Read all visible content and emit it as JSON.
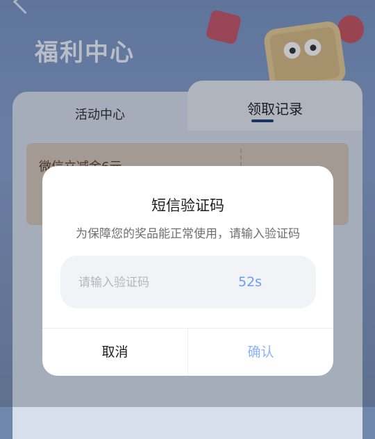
{
  "page": {
    "title": "福利中心",
    "tabs": [
      {
        "label": "活动中心",
        "active": false
      },
      {
        "label": "领取记录",
        "active": true
      }
    ],
    "card": {
      "text_partial": "微信立减金6元"
    }
  },
  "modal": {
    "title": "短信验证码",
    "description": "为保障您的奖品能正常使用，请输入验证码",
    "input": {
      "value": "",
      "placeholder": "请输入验证码"
    },
    "countdown": "52s",
    "cancel_label": "取消",
    "confirm_label": "确认"
  },
  "colors": {
    "accent": "#6b9cff",
    "confirm_disabled": "#8ab2ff",
    "field_bg": "#f1f3f6"
  }
}
